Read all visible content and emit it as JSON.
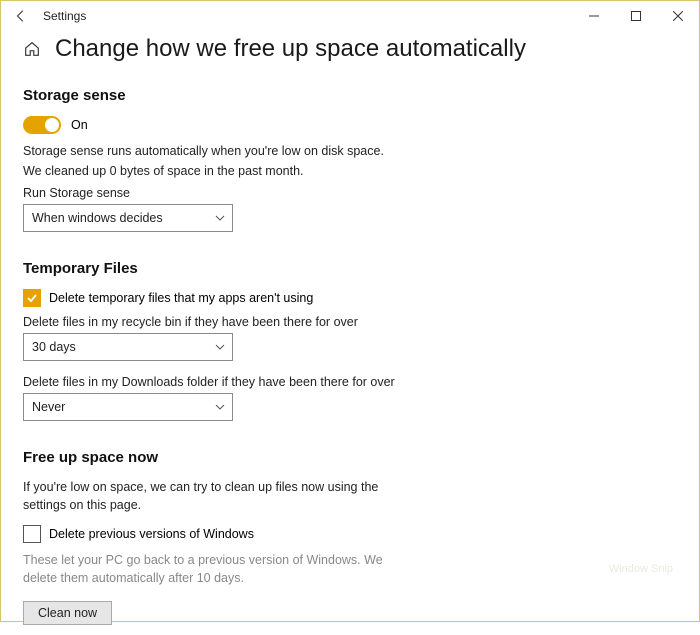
{
  "window": {
    "title": "Settings"
  },
  "page": {
    "title": "Change how we free up space automatically"
  },
  "storage_sense": {
    "heading": "Storage sense",
    "toggle_state": "On",
    "desc_line1": "Storage sense runs automatically when you're low on disk space.",
    "desc_line2": "We cleaned up 0 bytes of space in the past month.",
    "run_label": "Run Storage sense",
    "run_value": "When windows decides"
  },
  "temp": {
    "heading": "Temporary Files",
    "chk_label": "Delete temporary files that my apps aren't using",
    "recycle_label": "Delete files in my recycle bin if they have been there for over",
    "recycle_value": "30 days",
    "downloads_label": "Delete files in my Downloads folder if they have been there for over",
    "downloads_value": "Never"
  },
  "free": {
    "heading": "Free up space now",
    "desc": "If you're low on space, we can try to clean up files now using the settings on this page.",
    "chk_label": "Delete previous versions of Windows",
    "hint": "These let your PC go back to a previous version of Windows. We delete them automatically after 10 days.",
    "button": "Clean now"
  },
  "ghost": "Window Snip"
}
